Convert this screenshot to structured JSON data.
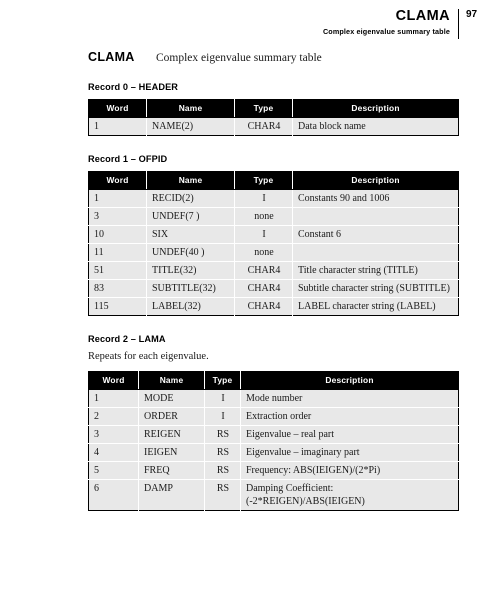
{
  "header": {
    "chapter": "CLAMA",
    "subtitle": "Complex eigenvalue summary table",
    "page_number": "97"
  },
  "doc": {
    "title": "CLAMA",
    "subtitle": "Complex eigenvalue summary table"
  },
  "columns": {
    "word": "Word",
    "name": "Name",
    "type": "Type",
    "description": "Description"
  },
  "records": [
    {
      "heading": "Record 0 – HEADER",
      "note": "",
      "rows": [
        {
          "word": "1",
          "name": "NAME(2)",
          "type": "CHAR4",
          "description": "Data block name"
        }
      ]
    },
    {
      "heading": "Record 1 – OFPID",
      "note": "",
      "rows": [
        {
          "word": "1",
          "name": "RECID(2)",
          "type": "I",
          "description": "Constants 90 and 1006"
        },
        {
          "word": "3",
          "name": "UNDEF(7 )",
          "type": "none",
          "description": ""
        },
        {
          "word": "10",
          "name": "SIX",
          "type": "I",
          "description": "Constant 6"
        },
        {
          "word": "11",
          "name": "UNDEF(40 )",
          "type": "none",
          "description": ""
        },
        {
          "word": "51",
          "name": "TITLE(32)",
          "type": "CHAR4",
          "description": "Title character string (TITLE)"
        },
        {
          "word": "83",
          "name": "SUBTITLE(32)",
          "type": "CHAR4",
          "description": "Subtitle character string (SUBTITLE)"
        },
        {
          "word": "115",
          "name": "LABEL(32)",
          "type": "CHAR4",
          "description": "LABEL character string (LABEL)"
        }
      ]
    },
    {
      "heading": "Record 2 – LAMA",
      "note": "Repeats for each eigenvalue.",
      "rows": [
        {
          "word": "1",
          "name": "MODE",
          "type": "I",
          "description": "Mode number"
        },
        {
          "word": "2",
          "name": "ORDER",
          "type": "I",
          "description": "Extraction order"
        },
        {
          "word": "3",
          "name": "REIGEN",
          "type": "RS",
          "description": "Eigenvalue – real part"
        },
        {
          "word": "4",
          "name": "IEIGEN",
          "type": "RS",
          "description": "Eigenvalue – imaginary part"
        },
        {
          "word": "5",
          "name": "FREQ",
          "type": "RS",
          "description": "Frequency: ABS(IEIGEN)/(2*Pi)"
        },
        {
          "word": "6",
          "name": "DAMP",
          "type": "RS",
          "description": "Damping Coefficient:\n(-2*REIGEN)/ABS(IEIGEN)"
        }
      ]
    }
  ]
}
